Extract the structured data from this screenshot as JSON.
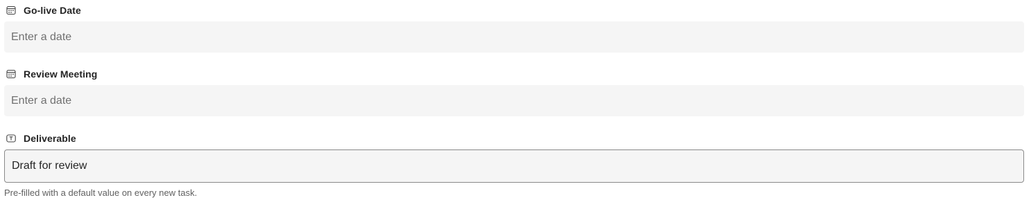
{
  "fields": [
    {
      "label": "Go-live Date",
      "icon": "calendar-icon",
      "placeholder": "Enter a date",
      "value": ""
    },
    {
      "label": "Review Meeting",
      "icon": "calendar-icon",
      "placeholder": "Enter a date",
      "value": ""
    },
    {
      "label": "Deliverable",
      "icon": "text-field-icon",
      "placeholder": "",
      "value": "Draft for review",
      "helper": "Pre-filled with a default value on every new task."
    }
  ],
  "colors": {
    "input_background": "#f5f5f5",
    "placeholder_text": "#707070",
    "label_text": "#242424",
    "helper_text": "#616161",
    "active_border": "#8a8a8a"
  }
}
